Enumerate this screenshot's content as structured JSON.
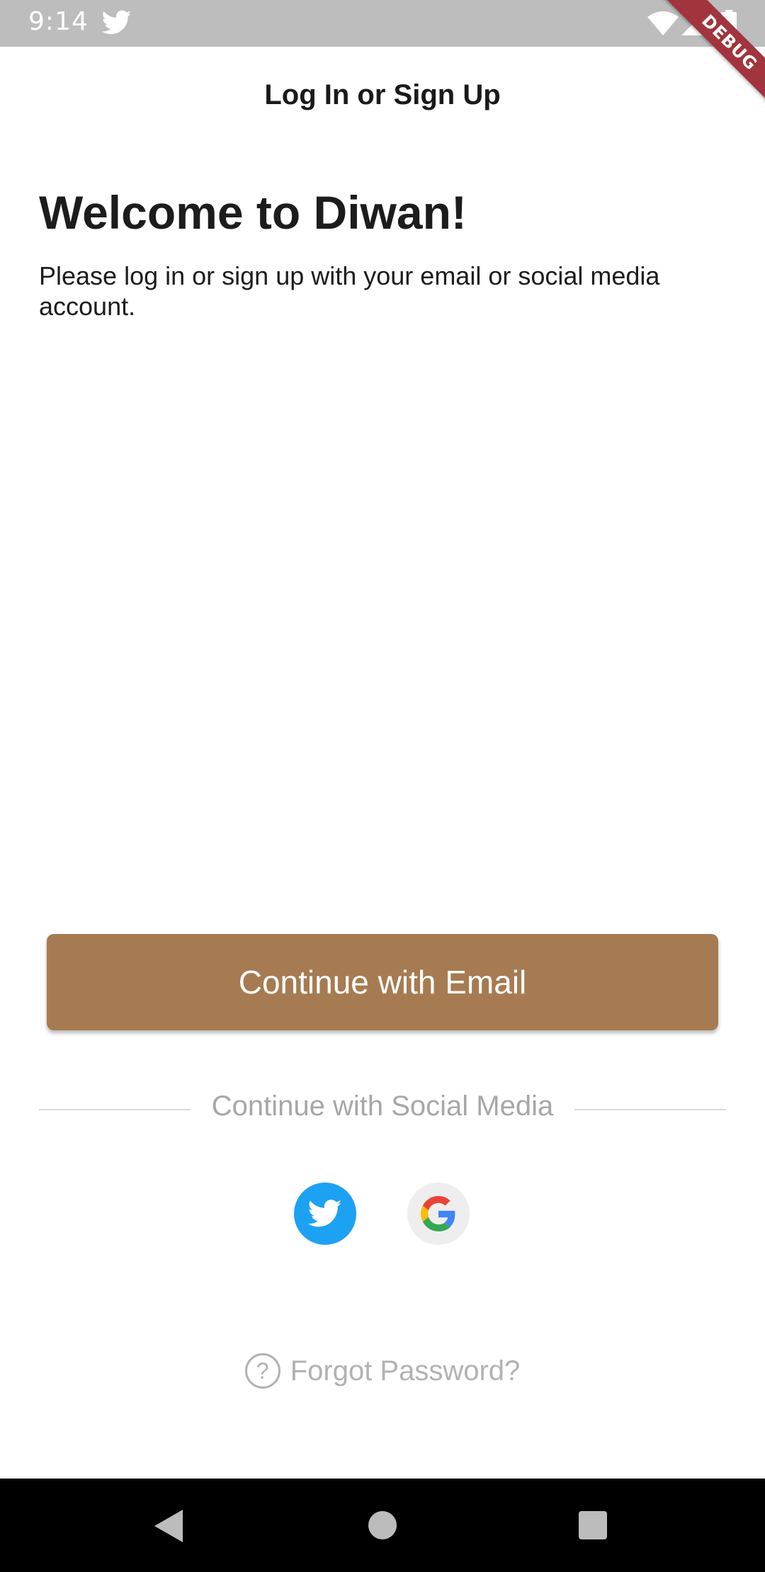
{
  "status_bar": {
    "time": "9:14",
    "icons": [
      "twitter-icon",
      "wifi-icon",
      "signal-icon",
      "battery-icon"
    ]
  },
  "debug_banner": "DEBUG",
  "app_bar": {
    "title": "Log In or Sign Up"
  },
  "welcome": {
    "title": "Welcome to Diwan!",
    "subtitle": "Please log in or sign up with your email or social media account."
  },
  "email_button": {
    "label": "Continue with Email"
  },
  "social": {
    "divider_label": "Continue with Social Media",
    "buttons": [
      "twitter-icon",
      "google-icon"
    ]
  },
  "forgot": {
    "icon": "?",
    "label": "Forgot Password?"
  },
  "nav_bar": {
    "buttons": [
      "back-icon",
      "home-icon",
      "recents-icon"
    ]
  },
  "colors": {
    "accent": "#a67b51",
    "twitter": "#1da1f2",
    "muted_text": "#a7a7a7",
    "debug_banner": "#a2343d"
  }
}
